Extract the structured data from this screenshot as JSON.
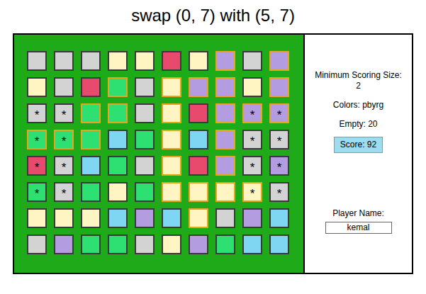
{
  "title": "swap (0, 7) with (5, 7)",
  "board": {
    "rows": [
      [
        {
          "color": "#d3d3d3",
          "mark": "",
          "highlighted": false
        },
        {
          "color": "#d3d3d3",
          "mark": "",
          "highlighted": false
        },
        {
          "color": "#d3d3d3",
          "mark": "",
          "highlighted": false
        },
        {
          "color": "#fff5c2",
          "mark": "",
          "highlighted": false
        },
        {
          "color": "#fff5c2",
          "mark": "",
          "highlighted": false
        },
        {
          "color": "#e84a6e",
          "mark": "",
          "highlighted": false
        },
        {
          "color": "#fff5c2",
          "mark": "",
          "highlighted": false
        },
        {
          "color": "#b39ce0",
          "mark": "",
          "highlighted": true
        },
        {
          "color": "#d3d3d3",
          "mark": "",
          "highlighted": false
        },
        {
          "color": "#b39ce0",
          "mark": "",
          "highlighted": true
        }
      ],
      [
        {
          "color": "#fff5c2",
          "mark": "",
          "highlighted": false
        },
        {
          "color": "#d3d3d3",
          "mark": "",
          "highlighted": false
        },
        {
          "color": "#e84a6e",
          "mark": "",
          "highlighted": false
        },
        {
          "color": "#2ee072",
          "mark": "",
          "highlighted": true
        },
        {
          "color": "#d3d3d3",
          "mark": "",
          "highlighted": false
        },
        {
          "color": "#fff5c2",
          "mark": "",
          "highlighted": true
        },
        {
          "color": "#b39ce0",
          "mark": "",
          "highlighted": true
        },
        {
          "color": "#b39ce0",
          "mark": "",
          "highlighted": true
        },
        {
          "color": "#fff5c2",
          "mark": "",
          "highlighted": false
        },
        {
          "color": "#b39ce0",
          "mark": "",
          "highlighted": true
        }
      ],
      [
        {
          "color": "#d3d3d3",
          "mark": "*",
          "highlighted": false
        },
        {
          "color": "#d3d3d3",
          "mark": "*",
          "highlighted": false
        },
        {
          "color": "#2ee072",
          "mark": "",
          "highlighted": true
        },
        {
          "color": "#2ee072",
          "mark": "",
          "highlighted": true
        },
        {
          "color": "#d3d3d3",
          "mark": "",
          "highlighted": false
        },
        {
          "color": "#fff5c2",
          "mark": "",
          "highlighted": true
        },
        {
          "color": "#e84a6e",
          "mark": "",
          "highlighted": false
        },
        {
          "color": "#b39ce0",
          "mark": "",
          "highlighted": true
        },
        {
          "color": "#b39ce0",
          "mark": "*",
          "highlighted": true
        },
        {
          "color": "#b39ce0",
          "mark": "*",
          "highlighted": true
        }
      ],
      [
        {
          "color": "#2ee072",
          "mark": "*",
          "highlighted": true
        },
        {
          "color": "#2ee072",
          "mark": "*",
          "highlighted": true
        },
        {
          "color": "#2ee072",
          "mark": "",
          "highlighted": true
        },
        {
          "color": "#7fd6f2",
          "mark": "",
          "highlighted": false
        },
        {
          "color": "#2ee072",
          "mark": "",
          "highlighted": false
        },
        {
          "color": "#fff5c2",
          "mark": "",
          "highlighted": true
        },
        {
          "color": "#7fd6f2",
          "mark": "",
          "highlighted": false
        },
        {
          "color": "#b39ce0",
          "mark": "",
          "highlighted": true
        },
        {
          "color": "#d3d3d3",
          "mark": "*",
          "highlighted": false
        },
        {
          "color": "#d3d3d3",
          "mark": "*",
          "highlighted": false
        }
      ],
      [
        {
          "color": "#e84a6e",
          "mark": "*",
          "highlighted": false
        },
        {
          "color": "#d3d3d3",
          "mark": "*",
          "highlighted": false
        },
        {
          "color": "#7fd6f2",
          "mark": "",
          "highlighted": false
        },
        {
          "color": "#2ee072",
          "mark": "",
          "highlighted": false
        },
        {
          "color": "#d3d3d3",
          "mark": "",
          "highlighted": false
        },
        {
          "color": "#fff5c2",
          "mark": "",
          "highlighted": true
        },
        {
          "color": "#e84a6e",
          "mark": "",
          "highlighted": false
        },
        {
          "color": "#b39ce0",
          "mark": "",
          "highlighted": true
        },
        {
          "color": "#d3d3d3",
          "mark": "*",
          "highlighted": false
        },
        {
          "color": "#b39ce0",
          "mark": "*",
          "highlighted": false
        }
      ],
      [
        {
          "color": "#2ee072",
          "mark": "*",
          "highlighted": false
        },
        {
          "color": "#d3d3d3",
          "mark": "*",
          "highlighted": false
        },
        {
          "color": "#2ee072",
          "mark": "",
          "highlighted": false
        },
        {
          "color": "#fff5c2",
          "mark": "",
          "highlighted": false
        },
        {
          "color": "#2ee072",
          "mark": "",
          "highlighted": false
        },
        {
          "color": "#fff5c2",
          "mark": "",
          "highlighted": true
        },
        {
          "color": "#fff5c2",
          "mark": "",
          "highlighted": true
        },
        {
          "color": "#fff5c2",
          "mark": "",
          "highlighted": true
        },
        {
          "color": "#fff5c2",
          "mark": "*",
          "highlighted": true
        },
        {
          "color": "#d3d3d3",
          "mark": "*",
          "highlighted": false
        }
      ],
      [
        {
          "color": "#fff5c2",
          "mark": "",
          "highlighted": false
        },
        {
          "color": "#fff5c2",
          "mark": "",
          "highlighted": false
        },
        {
          "color": "#fff5c2",
          "mark": "",
          "highlighted": false
        },
        {
          "color": "#7fd6f2",
          "mark": "",
          "highlighted": false
        },
        {
          "color": "#b39ce0",
          "mark": "",
          "highlighted": false
        },
        {
          "color": "#7fd6f2",
          "mark": "",
          "highlighted": false
        },
        {
          "color": "#fff5c2",
          "mark": "",
          "highlighted": true
        },
        {
          "color": "#d3d3d3",
          "mark": "",
          "highlighted": false
        },
        {
          "color": "#b39ce0",
          "mark": "",
          "highlighted": false
        },
        {
          "color": "#7fd6f2",
          "mark": "",
          "highlighted": false
        }
      ],
      [
        {
          "color": "#d3d3d3",
          "mark": "",
          "highlighted": false
        },
        {
          "color": "#b39ce0",
          "mark": "",
          "highlighted": false
        },
        {
          "color": "#2ee072",
          "mark": "",
          "highlighted": false
        },
        {
          "color": "#2ee072",
          "mark": "",
          "highlighted": false
        },
        {
          "color": "#d3d3d3",
          "mark": "",
          "highlighted": false
        },
        {
          "color": "#fff5c2",
          "mark": "",
          "highlighted": false
        },
        {
          "color": "#b39ce0",
          "mark": "",
          "highlighted": false
        },
        {
          "color": "#2ee072",
          "mark": "",
          "highlighted": false
        },
        {
          "color": "#7fd6f2",
          "mark": "",
          "highlighted": false
        },
        {
          "color": "#7fd6f2",
          "mark": "",
          "highlighted": false
        }
      ]
    ]
  },
  "sidebar": {
    "min_size_label": "Minimum Scoring Size:",
    "min_size": "2",
    "colors": "Colors: pbyrg",
    "empty": "Empty: 20",
    "score": "Score: 92",
    "player_label": "Player Name:",
    "player_name": "kemal"
  }
}
